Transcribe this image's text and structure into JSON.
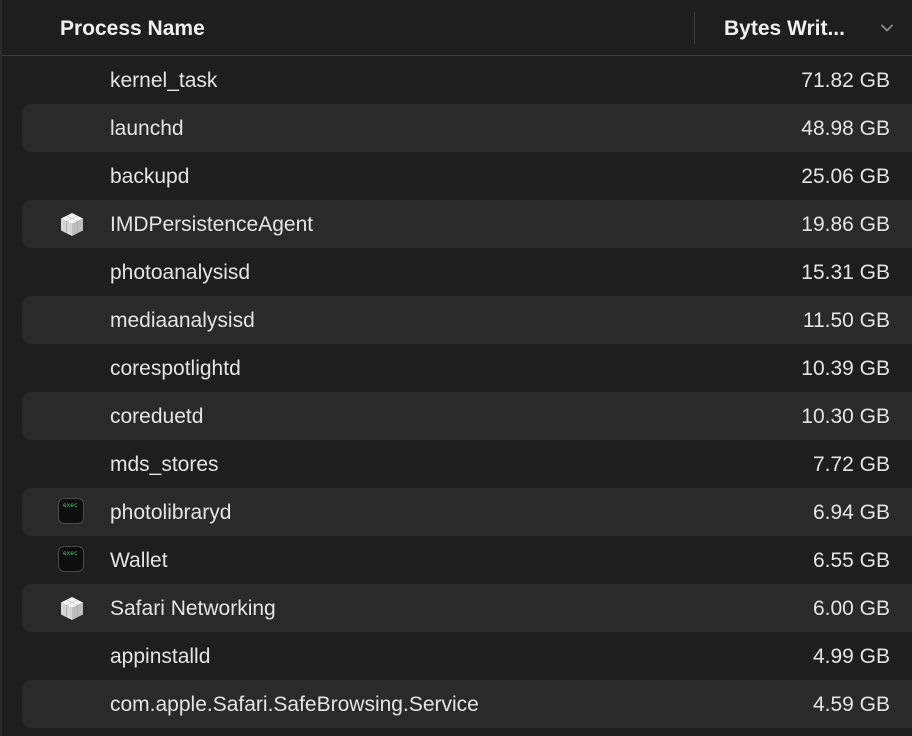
{
  "table": {
    "columns": {
      "name": "Process Name",
      "bytes": "Bytes Writ..."
    },
    "rows": [
      {
        "name": "kernel_task",
        "bytes": "71.82 GB",
        "icon": "none"
      },
      {
        "name": "launchd",
        "bytes": "48.98 GB",
        "icon": "none"
      },
      {
        "name": "backupd",
        "bytes": "25.06 GB",
        "icon": "none"
      },
      {
        "name": "IMDPersistenceAgent",
        "bytes": "19.86 GB",
        "icon": "app-bundle-icon"
      },
      {
        "name": "photoanalysisd",
        "bytes": "15.31 GB",
        "icon": "none"
      },
      {
        "name": "mediaanalysisd",
        "bytes": "11.50 GB",
        "icon": "none"
      },
      {
        "name": "corespotlightd",
        "bytes": "10.39 GB",
        "icon": "none"
      },
      {
        "name": "coreduetd",
        "bytes": "10.30 GB",
        "icon": "none"
      },
      {
        "name": "mds_stores",
        "bytes": "7.72 GB",
        "icon": "none"
      },
      {
        "name": "photolibraryd",
        "bytes": "6.94 GB",
        "icon": "exec-terminal-icon"
      },
      {
        "name": "Wallet",
        "bytes": "6.55 GB",
        "icon": "exec-terminal-icon"
      },
      {
        "name": "Safari Networking",
        "bytes": "6.00 GB",
        "icon": "app-bundle-icon"
      },
      {
        "name": "appinstalld",
        "bytes": "4.99 GB",
        "icon": "none"
      },
      {
        "name": "com.apple.Safari.SafeBrowsing.Service",
        "bytes": "4.59 GB",
        "icon": "none"
      }
    ]
  },
  "exec_label": "exec",
  "sort_icon": "chevron-down-icon"
}
